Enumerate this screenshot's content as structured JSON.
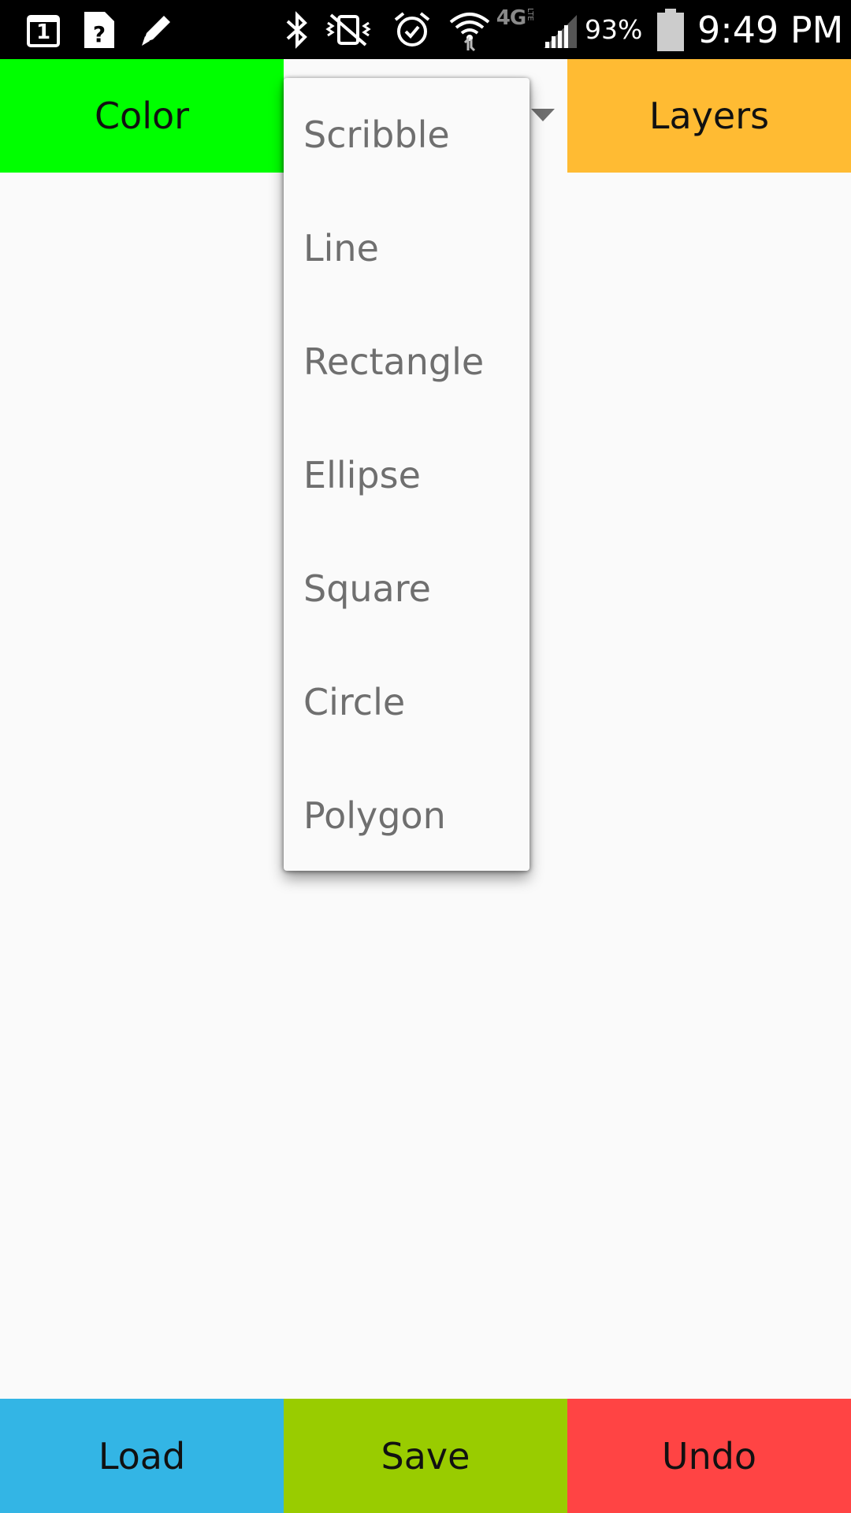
{
  "status_bar": {
    "notification_icons": [
      "calendar-icon",
      "unknown-file-icon",
      "pencil-icon"
    ],
    "calendar_day": "1",
    "system_icons": [
      "bluetooth-icon",
      "vibrate-mute-icon",
      "alarm-icon",
      "wifi-icon",
      "lte-icon",
      "signal-icon",
      "battery-icon"
    ],
    "network_label": "4G",
    "battery_percent": "93%",
    "battery_level": 0.93,
    "time": "9:49 PM"
  },
  "top_bar": {
    "color_button": {
      "label": "Color",
      "bg": "#00ff00"
    },
    "layers_button": {
      "label": "Layers",
      "bg": "#ffbb33"
    }
  },
  "tool_dropdown": {
    "expanded": true,
    "items": [
      "Scribble",
      "Line",
      "Rectangle",
      "Ellipse",
      "Square",
      "Circle",
      "Polygon"
    ]
  },
  "bottom_bar": {
    "load_button": {
      "label": "Load",
      "bg": "#33b5e5"
    },
    "save_button": {
      "label": "Save",
      "bg": "#99cc00"
    },
    "undo_button": {
      "label": "Undo",
      "bg": "#ff4444"
    }
  },
  "colors": {
    "status_bar_bg": "#000000",
    "canvas_bg": "#fafafa",
    "dropdown_text": "#6f6f6f"
  }
}
